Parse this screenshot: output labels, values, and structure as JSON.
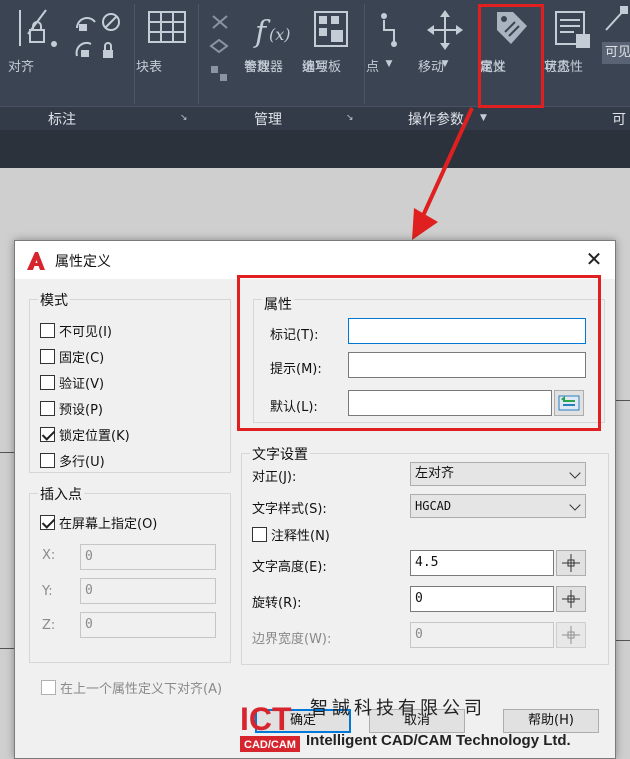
{
  "ribbon": {
    "buttons": {
      "align": "对齐",
      "block_table": "块表",
      "parameters_manager_1": "参数",
      "parameters_manager_2": "管理器",
      "block_editor_options_1": "编写",
      "block_editor_options_2": "选项板",
      "point": "点",
      "move": "移动",
      "attribute_definition_1": "属性",
      "attribute_definition_2": "定义",
      "visibility_states_1": "可见性",
      "visibility_states_2": "状态",
      "visibility_label": "可见",
      "cut_off": "可"
    },
    "panels": {
      "annotation": "标注",
      "manage": "管理",
      "action_parameters": "操作参数"
    }
  },
  "dialog": {
    "title": "属性定义",
    "close": "✕",
    "mode": {
      "title": "模式",
      "items": [
        {
          "label": "不可见(I)",
          "checked": false
        },
        {
          "label": "固定(C)",
          "checked": false
        },
        {
          "label": "验证(V)",
          "checked": false
        },
        {
          "label": "预设(P)",
          "checked": false
        },
        {
          "label": "锁定位置(K)",
          "checked": true
        },
        {
          "label": "多行(U)",
          "checked": false
        }
      ]
    },
    "attribute": {
      "title": "属性",
      "tag_label": "标记(T):",
      "tag_value": "",
      "prompt_label": "提示(M):",
      "prompt_value": "",
      "default_label": "默认(L):",
      "default_value": ""
    },
    "insertion_point": {
      "title": "插入点",
      "specify_on_screen": "在屏幕上指定(O)",
      "specify_checked": true,
      "x_label": "X:",
      "x_value": "0",
      "y_label": "Y:",
      "y_value": "0",
      "z_label": "Z:",
      "z_value": "0"
    },
    "text_settings": {
      "title": "文字设置",
      "justification_label": "对正(J):",
      "justification_value": "左对齐",
      "style_label": "文字样式(S):",
      "style_value": "HGCAD",
      "annotative_label": "注释性(N)",
      "annotative_checked": false,
      "height_label": "文字高度(E):",
      "height_value": "4.5",
      "rotation_label": "旋转(R):",
      "rotation_value": "0",
      "boundary_width_label": "边界宽度(W):",
      "boundary_width_value": "0"
    },
    "align_below_previous": "在上一个属性定义下对齐(A)",
    "buttons": {
      "ok": "确定",
      "cancel": "取消",
      "help": "帮助(H)"
    }
  },
  "watermark": {
    "logo_text_1": "ICT",
    "logo_text_2": "CAD/CAM",
    "company_cn": "智誠科技有限公司",
    "company_en": "Intelligent CAD/CAM Technology Ltd."
  },
  "colors": {
    "ribbon_bg": "#3b4453",
    "highlight": "#e02020",
    "focus": "#0078d7",
    "logo_red": "#d7252e"
  }
}
